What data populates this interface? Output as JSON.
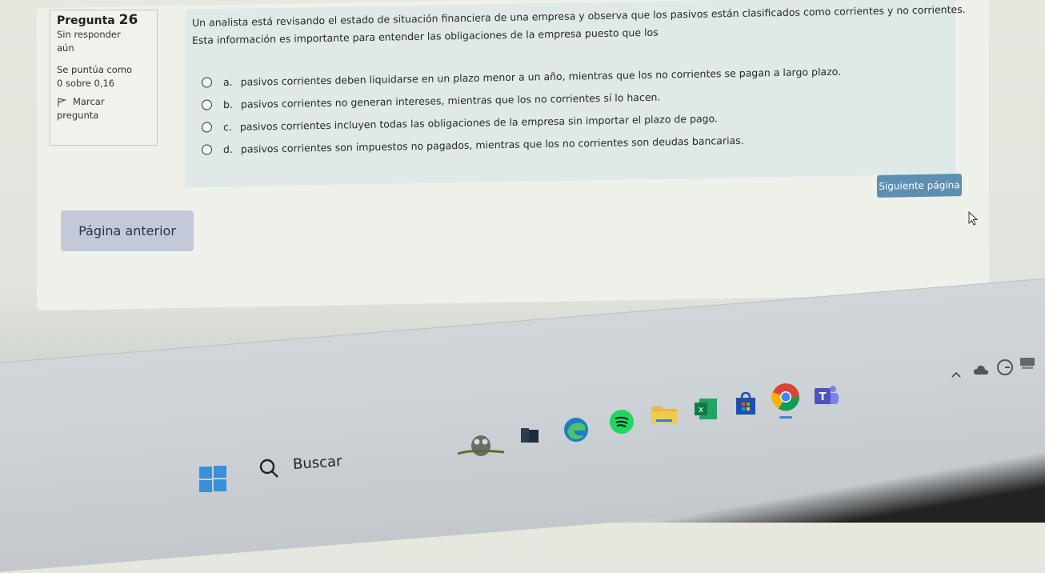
{
  "sidebar": {
    "question_label": "Pregunta",
    "question_number": "26",
    "status_line1": "Sin responder",
    "status_line2": "aún",
    "score_line1": "Se puntúa como",
    "score_line2": "0 sobre 0,16",
    "flag_line1": "Marcar",
    "flag_line2": "pregunta"
  },
  "question": {
    "text_line1": "Un analista está revisando el estado de situación financiera de una empresa y observa que los pasivos están clasificados como corrientes y no corrientes.",
    "text_line2": "Esta información es importante para entender las obligaciones de la empresa puesto que los",
    "options": [
      {
        "letter": "a.",
        "text": "pasivos corrientes deben liquidarse en un plazo menor a un año, mientras que los no corrientes se pagan a largo plazo."
      },
      {
        "letter": "b.",
        "text": "pasivos corrientes no generan intereses, mientras que los no corrientes sí lo hacen."
      },
      {
        "letter": "c.",
        "text": "pasivos corrientes incluyen todas las obligaciones de la empresa sin importar el plazo de pago."
      },
      {
        "letter": "d.",
        "text": "pasivos corrientes son impuestos no pagados, mientras que los no corrientes son deudas bancarias."
      }
    ]
  },
  "nav": {
    "next_label": "Siguiente página",
    "prev_label": "Página anterior"
  },
  "taskbar": {
    "search_label": "Buscar"
  },
  "colors": {
    "next_button": "#5c8fb2",
    "prev_button": "#c3c9d9",
    "question_bg": "#dfe9e8"
  }
}
